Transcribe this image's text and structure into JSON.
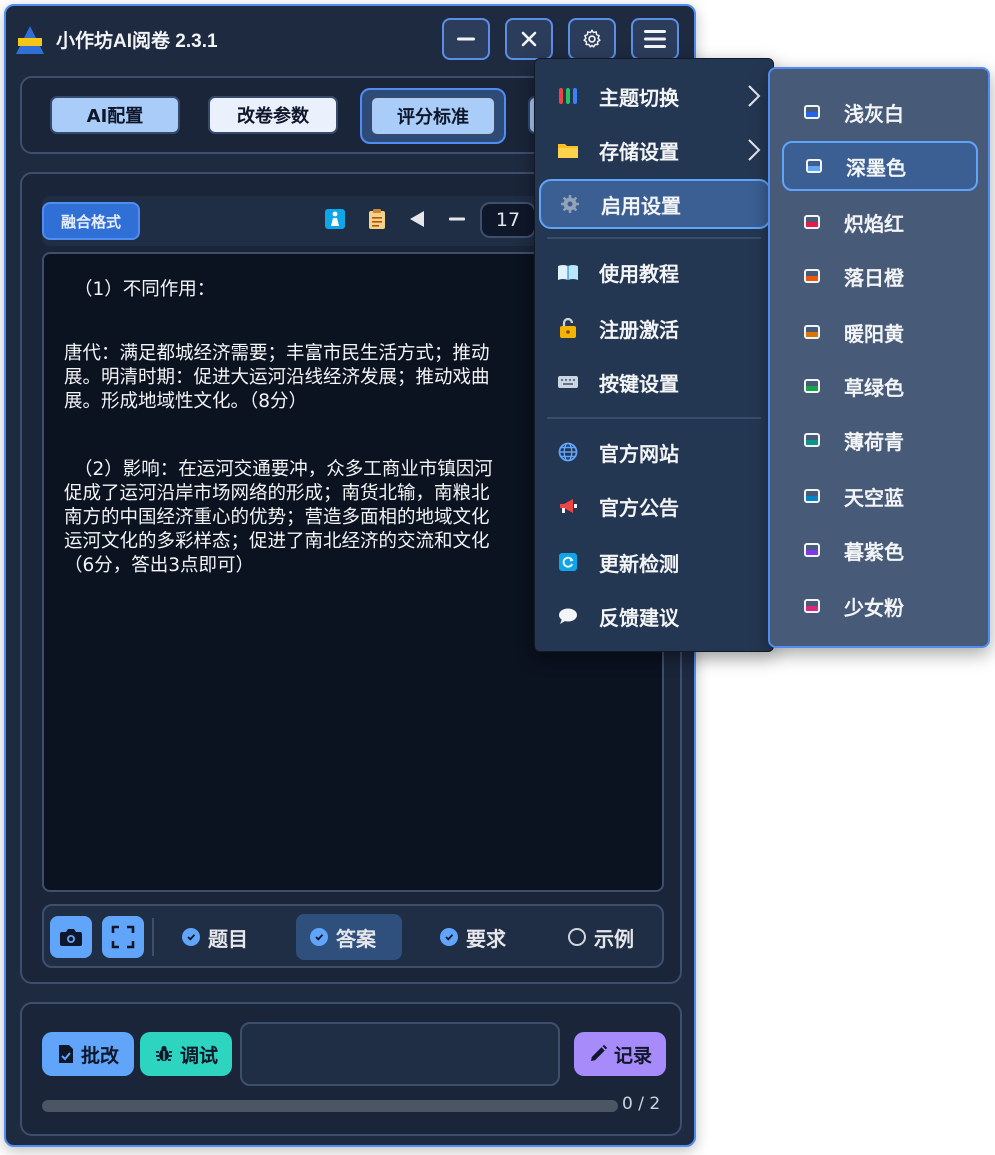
{
  "app": {
    "title": "小作坊AI阅卷 2.3.1"
  },
  "tabs": [
    {
      "label": "AI配置"
    },
    {
      "label": "改卷参数"
    },
    {
      "label": "评分标准"
    }
  ],
  "toolbar": {
    "merge_label": "融合格式",
    "page_value": "17"
  },
  "content": {
    "lines": [
      "（1）不同作用：",
      "唐代：满足都城经济需要；丰富市民生活方式；推动",
      "展。明清时期：促进大运河沿线经济发展；推动戏曲",
      "展。形成地域性文化。（8分）",
      "（2）影响：在运河交通要冲，众多工商业市镇因河",
      "促成了运河沿岸市场网络的形成；南货北输，南粮北",
      "南方的中国经济重心的优势；营造多面相的地域文化",
      "运河文化的多彩样态；促进了南北经济的交流和文化",
      "（6分，答出3点即可）"
    ]
  },
  "options": [
    {
      "label": "题目",
      "checked": true
    },
    {
      "label": "答案",
      "checked": true
    },
    {
      "label": "要求",
      "checked": true
    },
    {
      "label": "示例",
      "checked": false
    }
  ],
  "actions": {
    "grade_label": "批改",
    "debug_label": "调试",
    "record_label": "记录",
    "progress_text": "0 / 2",
    "progress_fraction": 0
  },
  "menu": {
    "items": [
      {
        "label": "主题切换",
        "icon": "palette-bars-icon"
      },
      {
        "label": "存储设置",
        "icon": "folder-icon"
      },
      {
        "label": "启用设置",
        "icon": "gear-icon"
      },
      {
        "label": "使用教程",
        "icon": "book-icon"
      },
      {
        "label": "注册激活",
        "icon": "lock-icon"
      },
      {
        "label": "按键设置",
        "icon": "keyboard-icon"
      },
      {
        "label": "官方网站",
        "icon": "globe-icon"
      },
      {
        "label": "官方公告",
        "icon": "megaphone-icon"
      },
      {
        "label": "更新检测",
        "icon": "refresh-icon"
      },
      {
        "label": "反馈建议",
        "icon": "speech-bubble-icon"
      }
    ]
  },
  "themes": {
    "items": [
      {
        "label": "浅灰白",
        "color": "#2563eb"
      },
      {
        "label": "深墨色",
        "color": "#60a5fa"
      },
      {
        "label": "炽焰红",
        "color": "#e11d48"
      },
      {
        "label": "落日橙",
        "color": "#ea580c"
      },
      {
        "label": "暖阳黄",
        "color": "#d97706"
      },
      {
        "label": "草绿色",
        "color": "#16a34a"
      },
      {
        "label": "薄荷青",
        "color": "#0d9488"
      },
      {
        "label": "天空蓝",
        "color": "#0284c7"
      },
      {
        "label": "暮紫色",
        "color": "#7c3aed"
      },
      {
        "label": "少女粉",
        "color": "#db2777"
      }
    ]
  }
}
